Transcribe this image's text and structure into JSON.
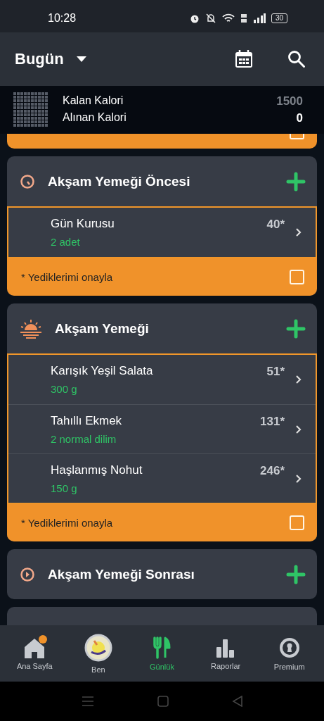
{
  "status_bar": {
    "time": "10:28",
    "battery": "30"
  },
  "app_bar": {
    "title": "Bugün"
  },
  "summary": {
    "rows": [
      {
        "label": "Kalan Kalori",
        "value": "1500",
        "kind": "muted"
      },
      {
        "label": "Alınan Kalori",
        "value": "0",
        "kind": "strong"
      }
    ]
  },
  "meals": [
    {
      "kind": "partial",
      "confirmed": false
    },
    {
      "kind": "evening-snack",
      "title": "Akşam Yemeği Öncesi",
      "items": [
        {
          "name": "Gün Kurusu",
          "calories": "40*",
          "amount": "2 adet"
        }
      ],
      "confirm_label": "* Yediklerimi onayla",
      "confirmed": false
    },
    {
      "kind": "dinner",
      "title": "Akşam Yemeği",
      "items": [
        {
          "name": "Karışık Yeşil Salata",
          "calories": "51*",
          "amount": "300 g"
        },
        {
          "name": "Tahıllı Ekmek",
          "calories": "131*",
          "amount": "2 normal dilim"
        },
        {
          "name": "Haşlanmış Nohut",
          "calories": "246*",
          "amount": "150 g"
        }
      ],
      "confirm_label": "* Yediklerimi onayla",
      "confirmed": false
    },
    {
      "kind": "after-dinner",
      "title": "Akşam Yemeği Sonrası"
    },
    {
      "kind": "cut"
    }
  ],
  "bottom_nav": [
    {
      "kind": "home",
      "label": "Ana Sayfa",
      "selected": false,
      "badge": true
    },
    {
      "kind": "avatar",
      "label": "Ben",
      "selected": false,
      "badge": false
    },
    {
      "kind": "diary",
      "label": "Günlük",
      "selected": true,
      "badge": false
    },
    {
      "kind": "reports",
      "label": "Raporlar",
      "selected": false,
      "badge": false
    },
    {
      "kind": "premium",
      "label": "Premium",
      "selected": false,
      "badge": false
    }
  ]
}
